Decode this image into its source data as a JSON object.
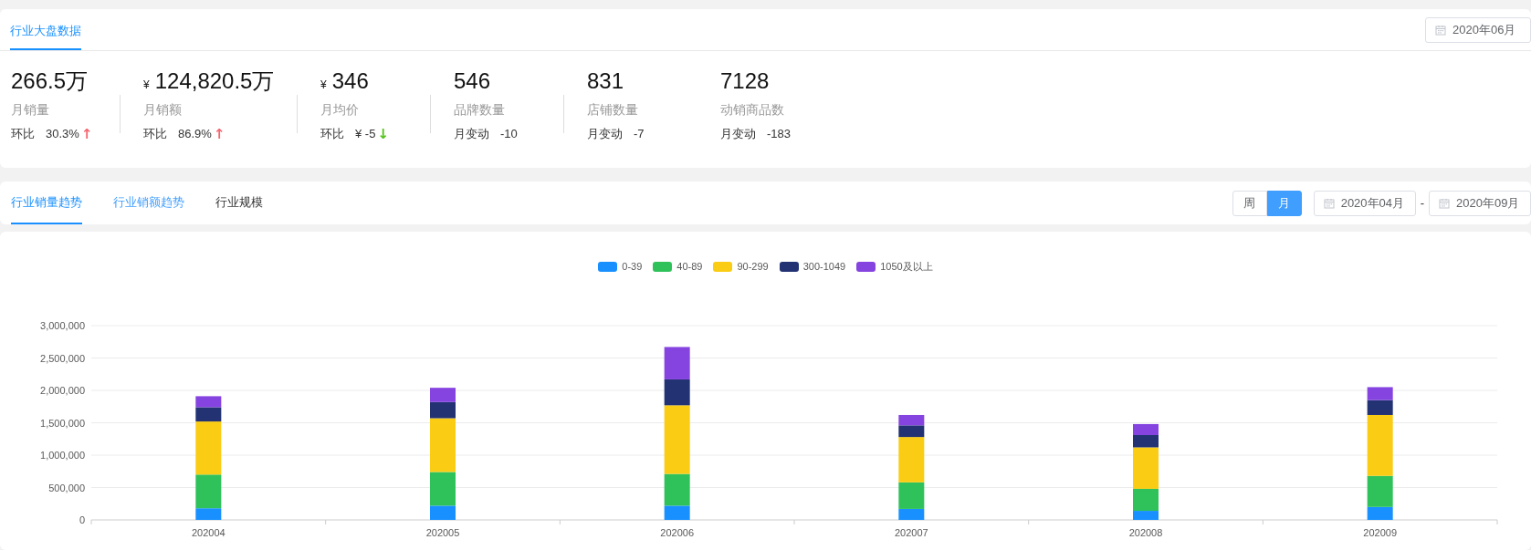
{
  "overview": {
    "tabs": [
      {
        "label": "行业大盘数据",
        "selected": true
      }
    ],
    "date_picker": {
      "value": "2020年06月"
    },
    "stats": [
      {
        "value": "266.5万",
        "label": "月销量",
        "change_label": "环比",
        "change_value": "30.3%",
        "arrow": "↑",
        "color": "#f5646e"
      },
      {
        "currency": "¥",
        "value": "124,820.5万",
        "label": "月销额",
        "change_label": "环比",
        "change_value": "86.9%",
        "arrow": "↑",
        "color": "#f5646e"
      },
      {
        "currency": "¥",
        "value": "346",
        "label": "月均价",
        "change_label": "环比",
        "change_value": "¥ -5",
        "arrow": "↓",
        "color": "#52c41a"
      },
      {
        "value": "546",
        "label": "品牌数量",
        "change_label": "月变动",
        "change_value": "-10"
      },
      {
        "value": "831",
        "label": "店铺数量",
        "change_label": "月变动",
        "change_value": "-7"
      },
      {
        "value": "7128",
        "label": "动销商品数",
        "change_label": "月变动",
        "change_value": "-183"
      }
    ]
  },
  "trend": {
    "tabs": [
      {
        "label": "行业销量趋势",
        "selected": true
      },
      {
        "label": "行业销额趋势",
        "selected": false
      },
      {
        "label": "行业规模",
        "selected": false
      }
    ],
    "period_buttons": [
      {
        "label": "周",
        "selected": false
      },
      {
        "label": "月",
        "selected": true
      }
    ],
    "date_range": {
      "start": "2020年04月",
      "separator": "-",
      "end": "2020年09月"
    }
  },
  "chart": {
    "chart_data": {
      "type": "bar",
      "stacked": true,
      "grid": true,
      "categories": [
        "202004",
        "202005",
        "202006",
        "202007",
        "202008",
        "202009"
      ],
      "series": [
        {
          "name": "0-39",
          "color": "#1890ff",
          "values": [
            180000,
            220000,
            220000,
            170000,
            140000,
            200000
          ]
        },
        {
          "name": "40-89",
          "color": "#2fc25b",
          "values": [
            520000,
            520000,
            490000,
            410000,
            340000,
            480000
          ]
        },
        {
          "name": "90-299",
          "color": "#facc14",
          "values": [
            820000,
            830000,
            1060000,
            700000,
            640000,
            940000
          ]
        },
        {
          "name": "300-1049",
          "color": "#223273",
          "values": [
            220000,
            250000,
            400000,
            180000,
            190000,
            230000
          ]
        },
        {
          "name": "1050及以上",
          "color": "#8543e0",
          "values": [
            170000,
            220000,
            500000,
            160000,
            170000,
            200000
          ]
        }
      ],
      "ylim": [
        0,
        3000000
      ],
      "yticks": [
        {
          "value": 0,
          "label": "0"
        },
        {
          "value": 500000,
          "label": "500,000"
        },
        {
          "value": 1000000,
          "label": "1,000,000"
        },
        {
          "value": 1500000,
          "label": "1,500,000"
        },
        {
          "value": 2000000,
          "label": "2,000,000"
        },
        {
          "value": 2500000,
          "label": "2,500,000"
        },
        {
          "value": 3000000,
          "label": "3,000,000"
        }
      ]
    }
  }
}
